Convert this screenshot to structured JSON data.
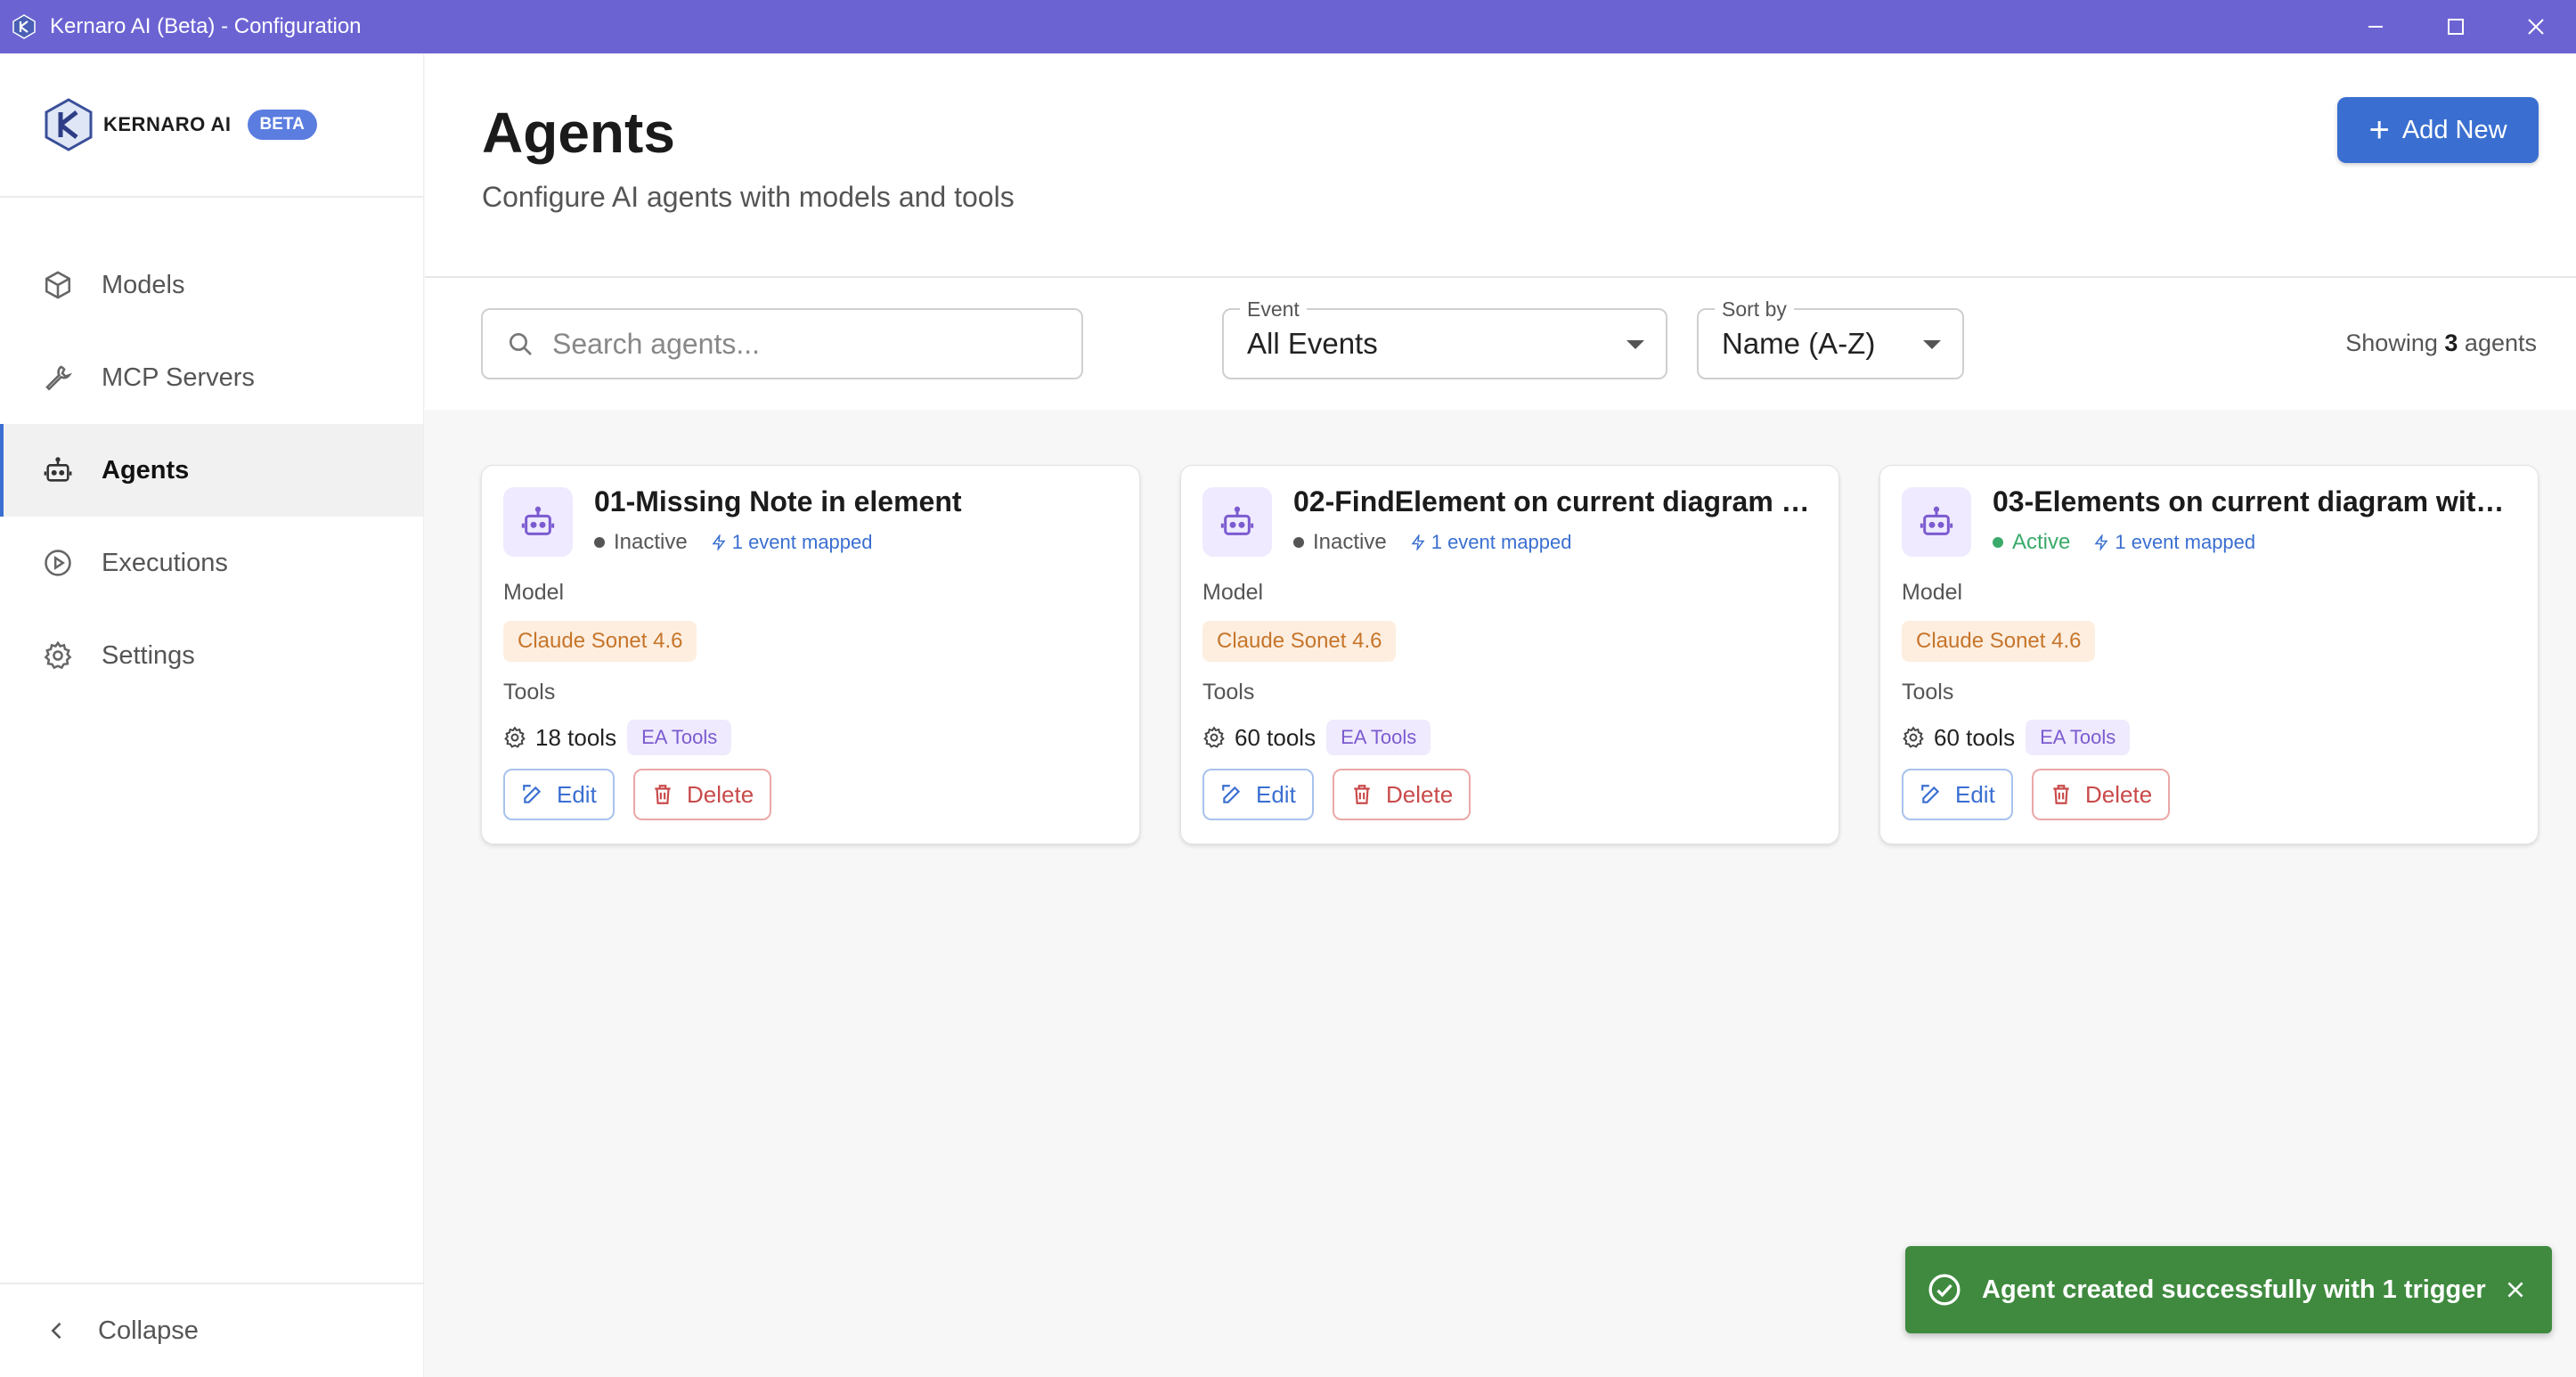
{
  "window": {
    "title": "Kernaro AI (Beta) - Configuration"
  },
  "sidebar": {
    "logo_text": "KERNARO AI",
    "beta_badge": "BETA",
    "items": [
      {
        "label": "Models",
        "icon": "cube-icon",
        "active": false
      },
      {
        "label": "MCP Servers",
        "icon": "wrench-icon",
        "active": false
      },
      {
        "label": "Agents",
        "icon": "robot-icon",
        "active": true
      },
      {
        "label": "Executions",
        "icon": "play-circle-icon",
        "active": false
      },
      {
        "label": "Settings",
        "icon": "gear-icon",
        "active": false
      }
    ],
    "collapse_label": "Collapse"
  },
  "header": {
    "title": "Agents",
    "subtitle": "Configure AI agents with models and tools",
    "add_button": "Add New"
  },
  "filters": {
    "search_placeholder": "Search agents...",
    "event_label": "Event",
    "event_value": "All Events",
    "sort_label": "Sort by",
    "sort_value": "Name (A-Z)",
    "showing_prefix": "Showing",
    "showing_count": "3",
    "showing_suffix": "agents"
  },
  "labels": {
    "model": "Model",
    "tools": "Tools",
    "edit": "Edit",
    "delete": "Delete"
  },
  "agents": [
    {
      "name": "01-Missing Note in element",
      "status": "Inactive",
      "events": "1 event mapped",
      "model": "Claude Sonet 4.6",
      "tools_count": "18 tools",
      "tool_group": "EA Tools"
    },
    {
      "name": "02-FindElement on current diagram wi...",
      "status": "Inactive",
      "events": "1 event mapped",
      "model": "Claude Sonet 4.6",
      "tools_count": "60 tools",
      "tool_group": "EA Tools"
    },
    {
      "name": "03-Elements on current diagram with ...",
      "status": "Active",
      "events": "1 event mapped",
      "model": "Claude Sonet 4.6",
      "tools_count": "60 tools",
      "tool_group": "EA Tools"
    }
  ],
  "toast": {
    "message": "Agent created successfully with 1 trigger"
  },
  "colors": {
    "titlebar": "#6c63d3",
    "primary": "#3a6fd1",
    "active_status": "#3aaa6a",
    "toast_bg": "#3f8a3f",
    "delete": "#c94a4a"
  }
}
